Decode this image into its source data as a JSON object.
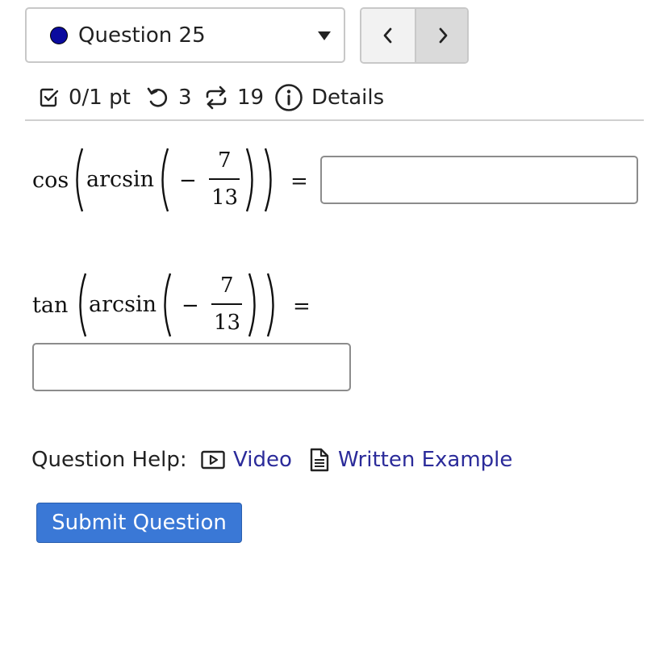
{
  "question_select": {
    "label": "Question 25",
    "status_color": "#0a0a9e"
  },
  "nav": {
    "prev_icon": "chevron-left-icon",
    "next_icon": "chevron-right-icon"
  },
  "info": {
    "score": "0/1 pt",
    "retries": "3",
    "attempts": "19",
    "details": "Details"
  },
  "problems": [
    {
      "func": "cos",
      "inner": "arcsin",
      "sign": "−",
      "numerator": "7",
      "denominator": "13",
      "equals": "="
    },
    {
      "func": "tan",
      "inner": "arcsin",
      "sign": "−",
      "numerator": "7",
      "denominator": "13",
      "equals": "="
    }
  ],
  "help": {
    "label": "Question Help:",
    "video": "Video",
    "written_example": "Written Example"
  },
  "submit": {
    "label": "Submit Question"
  }
}
